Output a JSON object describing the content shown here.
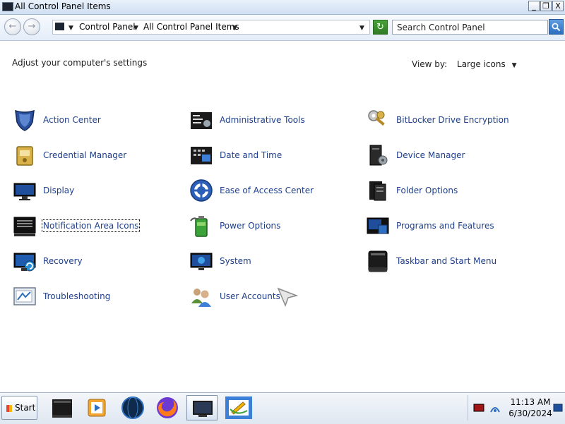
{
  "window": {
    "title": "All Control Panel Items",
    "buttons": {
      "minimize": "_",
      "restore": "❐",
      "close": "X"
    }
  },
  "address": {
    "back_glyph": "←",
    "forward_glyph": "→",
    "crumbs": [
      "Control Panel",
      "All Control Panel Items"
    ],
    "refresh_glyph": "↻",
    "search_placeholder": "Search Control Panel"
  },
  "content": {
    "subtitle": "Adjust your computer's settings",
    "view_by_label": "View by:",
    "view_by_value": "Large icons",
    "items": [
      {
        "label": "Action Center",
        "icon": "shield-icon"
      },
      {
        "label": "Administrative Tools",
        "icon": "admin-tools-icon"
      },
      {
        "label": "BitLocker Drive Encryption",
        "icon": "bitlocker-key-icon"
      },
      {
        "label": "Credential Manager",
        "icon": "credential-vault-icon"
      },
      {
        "label": "Date and Time",
        "icon": "calendar-clock-icon"
      },
      {
        "label": "Device Manager",
        "icon": "device-manager-icon"
      },
      {
        "label": "Display",
        "icon": "monitor-icon"
      },
      {
        "label": "Ease of Access Center",
        "icon": "ease-of-access-icon"
      },
      {
        "label": "Folder Options",
        "icon": "folder-options-icon"
      },
      {
        "label": "Notification Area Icons",
        "icon": "notification-area-icon"
      },
      {
        "label": "Power Options",
        "icon": "battery-icon"
      },
      {
        "label": "Programs and Features",
        "icon": "programs-icon"
      },
      {
        "label": "Recovery",
        "icon": "recovery-icon"
      },
      {
        "label": "System",
        "icon": "system-icon"
      },
      {
        "label": "Taskbar and Start Menu",
        "icon": "taskbar-icon"
      },
      {
        "label": "Troubleshooting",
        "icon": "troubleshooting-icon"
      },
      {
        "label": "User Accounts",
        "icon": "user-accounts-icon"
      }
    ]
  },
  "taskbar": {
    "start_label": "Start",
    "apps": [
      "terminal-app-icon",
      "media-player-icon",
      "globe-app-icon",
      "firefox-icon",
      "control-panel-app-icon",
      "paint-app-icon"
    ],
    "time": "11:13 AM",
    "date": "6/30/2024"
  }
}
